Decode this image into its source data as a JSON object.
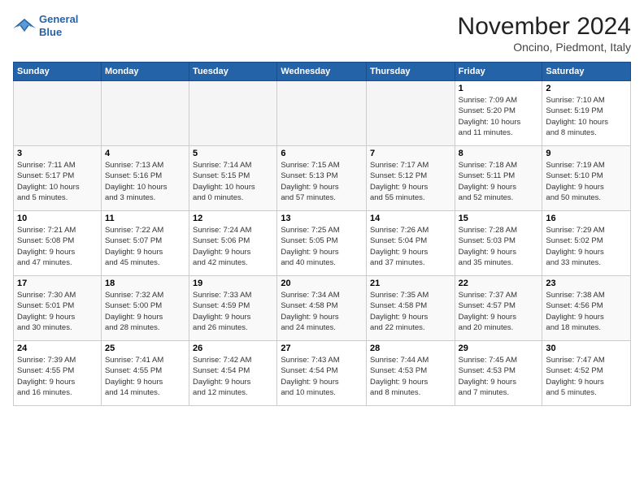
{
  "logo": {
    "line1": "General",
    "line2": "Blue"
  },
  "title": "November 2024",
  "location": "Oncino, Piedmont, Italy",
  "weekdays": [
    "Sunday",
    "Monday",
    "Tuesday",
    "Wednesday",
    "Thursday",
    "Friday",
    "Saturday"
  ],
  "weeks": [
    [
      {
        "day": "",
        "info": ""
      },
      {
        "day": "",
        "info": ""
      },
      {
        "day": "",
        "info": ""
      },
      {
        "day": "",
        "info": ""
      },
      {
        "day": "",
        "info": ""
      },
      {
        "day": "1",
        "info": "Sunrise: 7:09 AM\nSunset: 5:20 PM\nDaylight: 10 hours\nand 11 minutes."
      },
      {
        "day": "2",
        "info": "Sunrise: 7:10 AM\nSunset: 5:19 PM\nDaylight: 10 hours\nand 8 minutes."
      }
    ],
    [
      {
        "day": "3",
        "info": "Sunrise: 7:11 AM\nSunset: 5:17 PM\nDaylight: 10 hours\nand 5 minutes."
      },
      {
        "day": "4",
        "info": "Sunrise: 7:13 AM\nSunset: 5:16 PM\nDaylight: 10 hours\nand 3 minutes."
      },
      {
        "day": "5",
        "info": "Sunrise: 7:14 AM\nSunset: 5:15 PM\nDaylight: 10 hours\nand 0 minutes."
      },
      {
        "day": "6",
        "info": "Sunrise: 7:15 AM\nSunset: 5:13 PM\nDaylight: 9 hours\nand 57 minutes."
      },
      {
        "day": "7",
        "info": "Sunrise: 7:17 AM\nSunset: 5:12 PM\nDaylight: 9 hours\nand 55 minutes."
      },
      {
        "day": "8",
        "info": "Sunrise: 7:18 AM\nSunset: 5:11 PM\nDaylight: 9 hours\nand 52 minutes."
      },
      {
        "day": "9",
        "info": "Sunrise: 7:19 AM\nSunset: 5:10 PM\nDaylight: 9 hours\nand 50 minutes."
      }
    ],
    [
      {
        "day": "10",
        "info": "Sunrise: 7:21 AM\nSunset: 5:08 PM\nDaylight: 9 hours\nand 47 minutes."
      },
      {
        "day": "11",
        "info": "Sunrise: 7:22 AM\nSunset: 5:07 PM\nDaylight: 9 hours\nand 45 minutes."
      },
      {
        "day": "12",
        "info": "Sunrise: 7:24 AM\nSunset: 5:06 PM\nDaylight: 9 hours\nand 42 minutes."
      },
      {
        "day": "13",
        "info": "Sunrise: 7:25 AM\nSunset: 5:05 PM\nDaylight: 9 hours\nand 40 minutes."
      },
      {
        "day": "14",
        "info": "Sunrise: 7:26 AM\nSunset: 5:04 PM\nDaylight: 9 hours\nand 37 minutes."
      },
      {
        "day": "15",
        "info": "Sunrise: 7:28 AM\nSunset: 5:03 PM\nDaylight: 9 hours\nand 35 minutes."
      },
      {
        "day": "16",
        "info": "Sunrise: 7:29 AM\nSunset: 5:02 PM\nDaylight: 9 hours\nand 33 minutes."
      }
    ],
    [
      {
        "day": "17",
        "info": "Sunrise: 7:30 AM\nSunset: 5:01 PM\nDaylight: 9 hours\nand 30 minutes."
      },
      {
        "day": "18",
        "info": "Sunrise: 7:32 AM\nSunset: 5:00 PM\nDaylight: 9 hours\nand 28 minutes."
      },
      {
        "day": "19",
        "info": "Sunrise: 7:33 AM\nSunset: 4:59 PM\nDaylight: 9 hours\nand 26 minutes."
      },
      {
        "day": "20",
        "info": "Sunrise: 7:34 AM\nSunset: 4:58 PM\nDaylight: 9 hours\nand 24 minutes."
      },
      {
        "day": "21",
        "info": "Sunrise: 7:35 AM\nSunset: 4:58 PM\nDaylight: 9 hours\nand 22 minutes."
      },
      {
        "day": "22",
        "info": "Sunrise: 7:37 AM\nSunset: 4:57 PM\nDaylight: 9 hours\nand 20 minutes."
      },
      {
        "day": "23",
        "info": "Sunrise: 7:38 AM\nSunset: 4:56 PM\nDaylight: 9 hours\nand 18 minutes."
      }
    ],
    [
      {
        "day": "24",
        "info": "Sunrise: 7:39 AM\nSunset: 4:55 PM\nDaylight: 9 hours\nand 16 minutes."
      },
      {
        "day": "25",
        "info": "Sunrise: 7:41 AM\nSunset: 4:55 PM\nDaylight: 9 hours\nand 14 minutes."
      },
      {
        "day": "26",
        "info": "Sunrise: 7:42 AM\nSunset: 4:54 PM\nDaylight: 9 hours\nand 12 minutes."
      },
      {
        "day": "27",
        "info": "Sunrise: 7:43 AM\nSunset: 4:54 PM\nDaylight: 9 hours\nand 10 minutes."
      },
      {
        "day": "28",
        "info": "Sunrise: 7:44 AM\nSunset: 4:53 PM\nDaylight: 9 hours\nand 8 minutes."
      },
      {
        "day": "29",
        "info": "Sunrise: 7:45 AM\nSunset: 4:53 PM\nDaylight: 9 hours\nand 7 minutes."
      },
      {
        "day": "30",
        "info": "Sunrise: 7:47 AM\nSunset: 4:52 PM\nDaylight: 9 hours\nand 5 minutes."
      }
    ]
  ]
}
